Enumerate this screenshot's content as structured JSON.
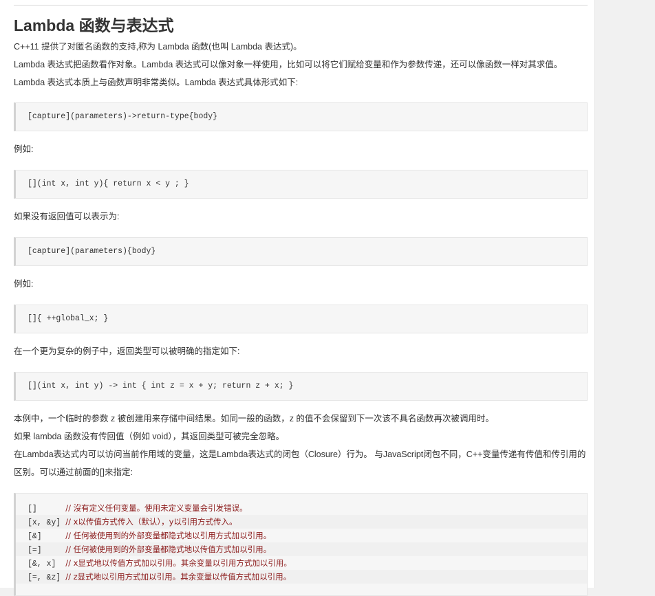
{
  "heading": "Lambda 函数与表达式",
  "intro": [
    "C++11 提供了对匿名函数的支持,称为 Lambda 函数(也叫 Lambda 表达式)。",
    "Lambda 表达式把函数看作对象。Lambda 表达式可以像对象一样使用，比如可以将它们赋给变量和作为参数传递，还可以像函数一样对其求值。",
    "Lambda 表达式本质上与函数声明非常类似。Lambda 表达式具体形式如下:"
  ],
  "code1": "[capture](parameters)->return-type{body}",
  "example_label_1": "例如:",
  "code2": "[](int x, int y){ return x < y ; }",
  "no_return_text": "如果没有返回值可以表示为:",
  "code3": "[capture](parameters){body}",
  "example_label_2": "例如:",
  "code4": "[]{ ++global_x; }",
  "complex_text": "在一个更为复杂的例子中，返回类型可以被明确的指定如下:",
  "code5": "[](int x, int y) -> int { int z = x + y; return z + x; }",
  "para_temp": "本例中，一个临时的参数 z 被创建用来存储中间结果。如同一般的函数，z 的值不会保留到下一次该不具名函数再次被调用时。",
  "para_void": "如果 lambda 函数没有传回值（例如 void），其返回类型可被完全忽略。",
  "para_closure": "在Lambda表达式内可以访问当前作用域的变量，这是Lambda表达式的闭包（Closure）行为。 与JavaScript闭包不同，C++变量传递有传值和传引用的区别。可以通过前面的[]来指定:",
  "capture_table": [
    {
      "code": "[]      ",
      "comment": "// 沒有定义任何变量。使用未定义变量会引发错误。"
    },
    {
      "code": "[x, &y] ",
      "comment": "// x以传值方式传入（默认），y以引用方式传入。"
    },
    {
      "code": "[&]     ",
      "comment": "// 任何被使用到的外部变量都隐式地以引用方式加以引用。"
    },
    {
      "code": "[=]     ",
      "comment": "// 任何被使用到的外部变量都隐式地以传值方式加以引用。"
    },
    {
      "code": "[&, x]  ",
      "comment": "// x显式地以传值方式加以引用。其余变量以引用方式加以引用。"
    },
    {
      "code": "[=, &z] ",
      "comment": "// z显式地以引用方式加以引用。其余变量以传值方式加以引用。"
    }
  ]
}
